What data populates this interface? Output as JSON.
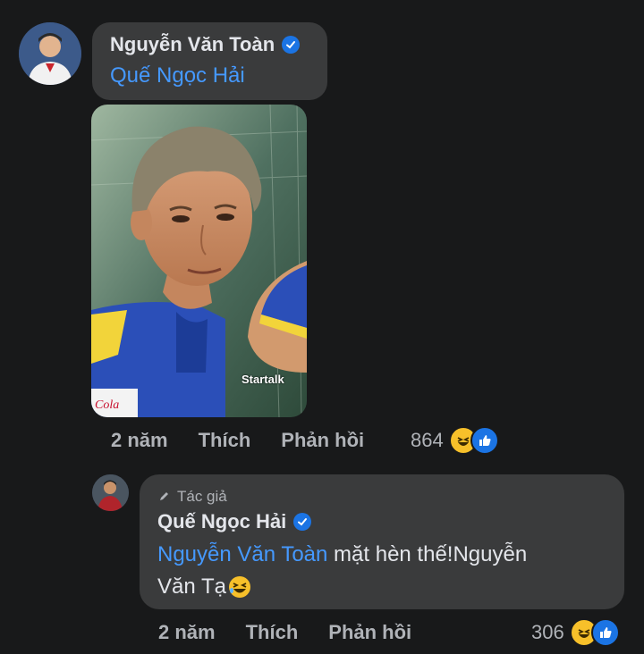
{
  "comment": {
    "author": "Nguyễn Văn Toàn",
    "mention": "Quế Ngọc Hải",
    "actions": {
      "time": "2 năm",
      "like": "Thích",
      "reply": "Phản hồi"
    },
    "reaction_count": "864",
    "photo_watermark": "Startalk"
  },
  "reply": {
    "badge": "Tác giả",
    "author": "Quế Ngọc Hải",
    "mention": "Nguyễn Văn Toàn",
    "text_line1": " mặt hèn thế!Nguyễn",
    "text_line2": "Văn Tạ",
    "actions": {
      "time": "2 năm",
      "like": "Thích",
      "reply": "Phản hồi"
    },
    "reaction_count": "306"
  },
  "colors": {
    "background": "#18191a",
    "bubble": "#3a3b3c",
    "mention": "#4599ff",
    "verified": "#1b74e4",
    "muted": "#b0b3b8"
  }
}
